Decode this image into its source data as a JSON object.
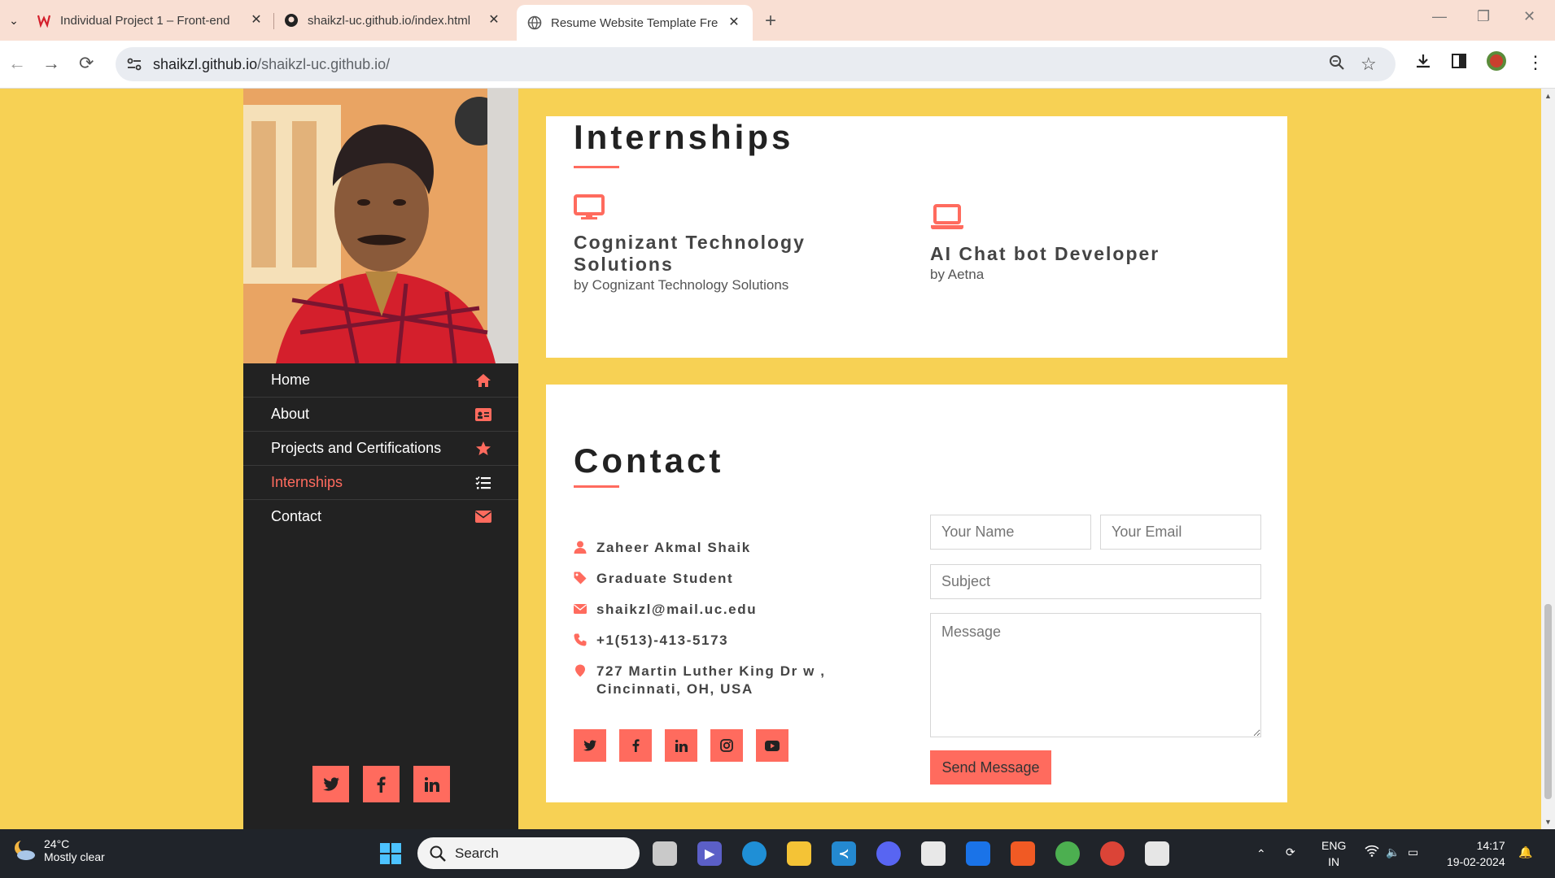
{
  "browser": {
    "tabs": [
      {
        "title": "Individual Project 1 – Front-end"
      },
      {
        "title": "shaikzl-uc.github.io/index.html"
      },
      {
        "title": "Resume Website Template Free"
      }
    ],
    "url_host": "shaikzl.github.io",
    "url_path": "/shaikzl-uc.github.io/"
  },
  "sidebar": {
    "nav": [
      {
        "label": "Home",
        "icon": "home-icon"
      },
      {
        "label": "About",
        "icon": "id-card-icon"
      },
      {
        "label": "Projects and Certifications",
        "icon": "star-icon"
      },
      {
        "label": "Internships",
        "icon": "tasks-icon"
      },
      {
        "label": "Contact",
        "icon": "envelope-icon"
      }
    ],
    "social": [
      "twitter-icon",
      "facebook-icon",
      "linkedin-icon"
    ]
  },
  "internships": {
    "heading": "Internships",
    "items": [
      {
        "title": "Cognizant Technology Solutions",
        "by": "by Cognizant Technology Solutions",
        "icon": "desktop-icon"
      },
      {
        "title": "AI Chat bot Developer",
        "by": "by Aetna",
        "icon": "laptop-icon"
      }
    ]
  },
  "contact": {
    "heading": "Contact",
    "name": "Zaheer Akmal Shaik",
    "role": "Graduate Student",
    "email": "shaikzl@mail.uc.edu",
    "phone": "+1(513)-413-5173",
    "address": "727 Martin Luther King Dr w , Cincinnati, OH, USA",
    "form": {
      "name_placeholder": "Your Name",
      "email_placeholder": "Your Email",
      "subject_placeholder": "Subject",
      "message_placeholder": "Message",
      "send_label": "Send Message"
    },
    "social": [
      "twitter-icon",
      "facebook-icon",
      "linkedin-icon",
      "instagram-icon",
      "youtube-icon"
    ]
  },
  "taskbar": {
    "temperature": "24°C",
    "weather": "Mostly clear",
    "search_placeholder": "Search",
    "lang_top": "ENG",
    "lang_bottom": "IN",
    "time": "14:17",
    "date": "19-02-2024"
  },
  "colors": {
    "accent": "#ff6b5e",
    "page_bg": "#f7d154",
    "sidebar_bg": "#222222"
  }
}
